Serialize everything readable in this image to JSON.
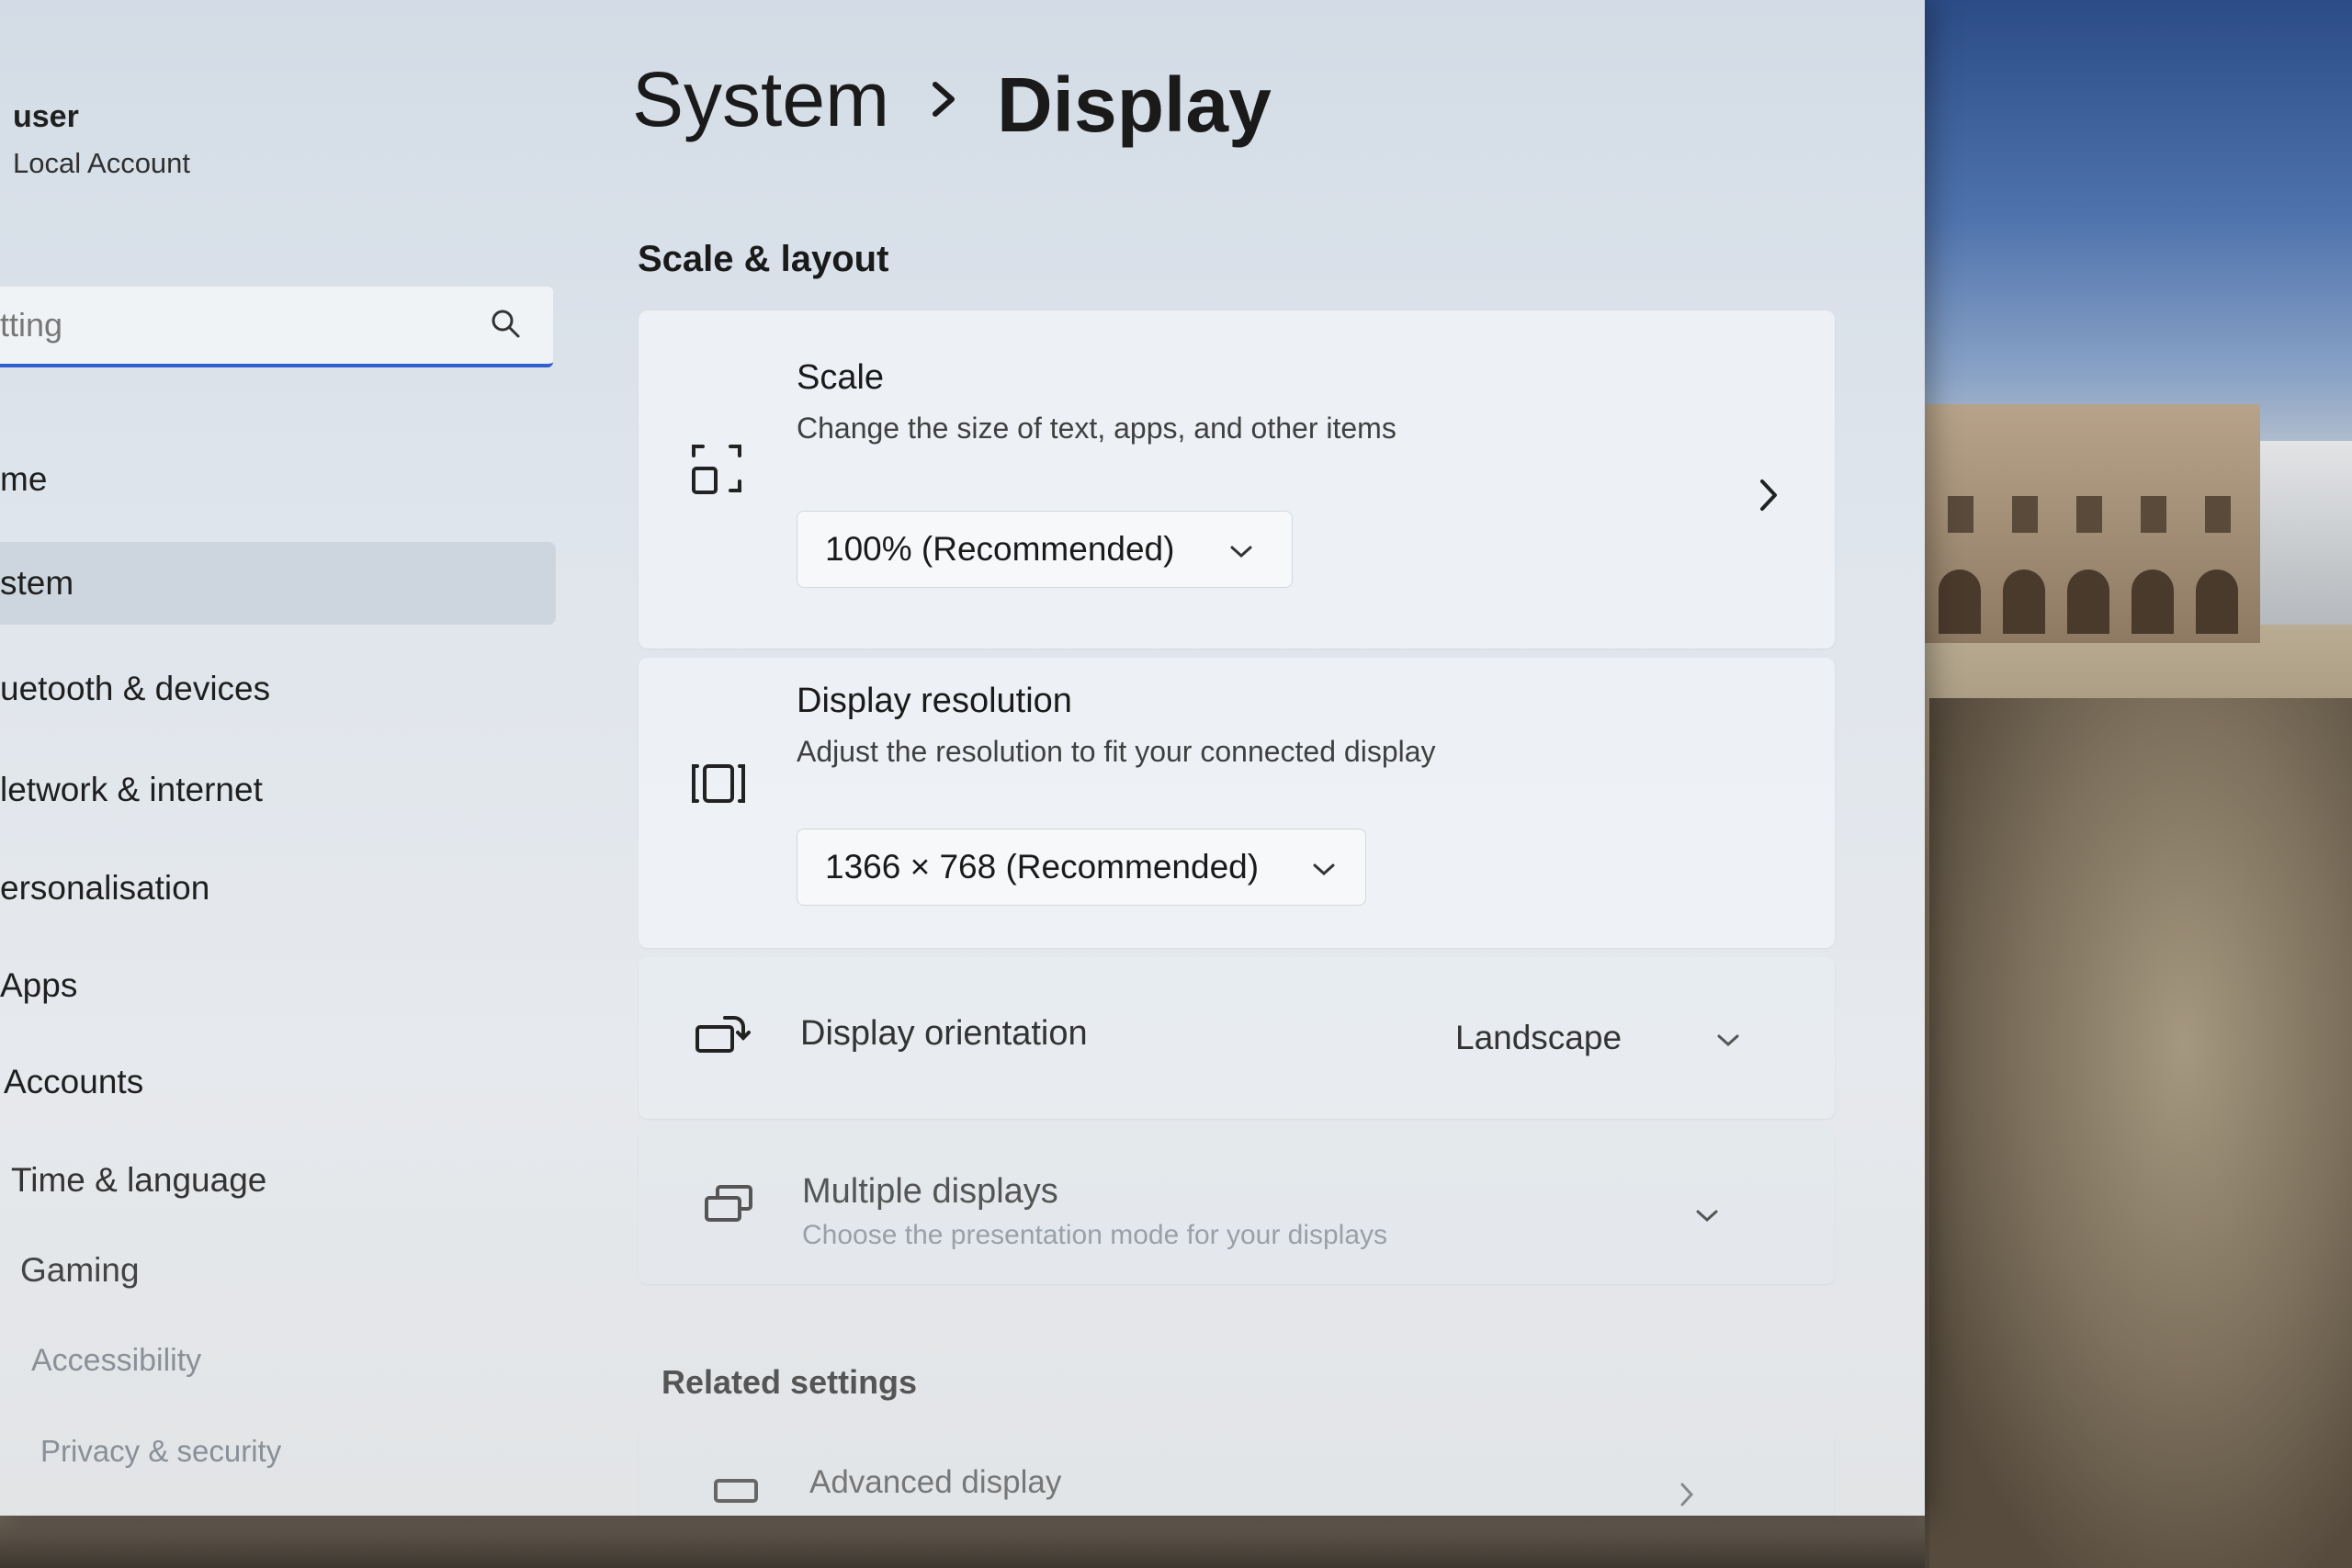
{
  "sidebar": {
    "user_name": "user",
    "user_type": "Local Account",
    "search_placeholder": "tting",
    "items": [
      {
        "label": "me"
      },
      {
        "label": "stem",
        "selected": true
      },
      {
        "label": "uetooth & devices"
      },
      {
        "label": "letwork & internet"
      },
      {
        "label": "ersonalisation"
      },
      {
        "label": "Apps"
      },
      {
        "label": "Accounts"
      },
      {
        "label": "Time & language"
      },
      {
        "label": "Gaming"
      },
      {
        "label": "Accessibility"
      },
      {
        "label": "Privacy & security"
      }
    ]
  },
  "breadcrumb": {
    "parent": "System",
    "current": "Display"
  },
  "scale_layout": {
    "heading": "Scale & layout",
    "scale": {
      "title": "Scale",
      "description": "Change the size of text, apps, and other items",
      "value": "100% (Recommended)"
    },
    "resolution": {
      "title": "Display resolution",
      "description": "Adjust the resolution to fit your connected display",
      "value": "1366 × 768 (Recommended)"
    },
    "orientation": {
      "title": "Display orientation",
      "value": "Landscape"
    },
    "multiple_displays": {
      "title": "Multiple displays",
      "description": "Choose the presentation mode for your displays"
    }
  },
  "related": {
    "heading": "Related settings",
    "advanced_display": "Advanced display"
  },
  "colors": {
    "accent": "#2f5fd0",
    "window_bg": "#dfe5ec",
    "card_bg": "#eef2f6"
  }
}
